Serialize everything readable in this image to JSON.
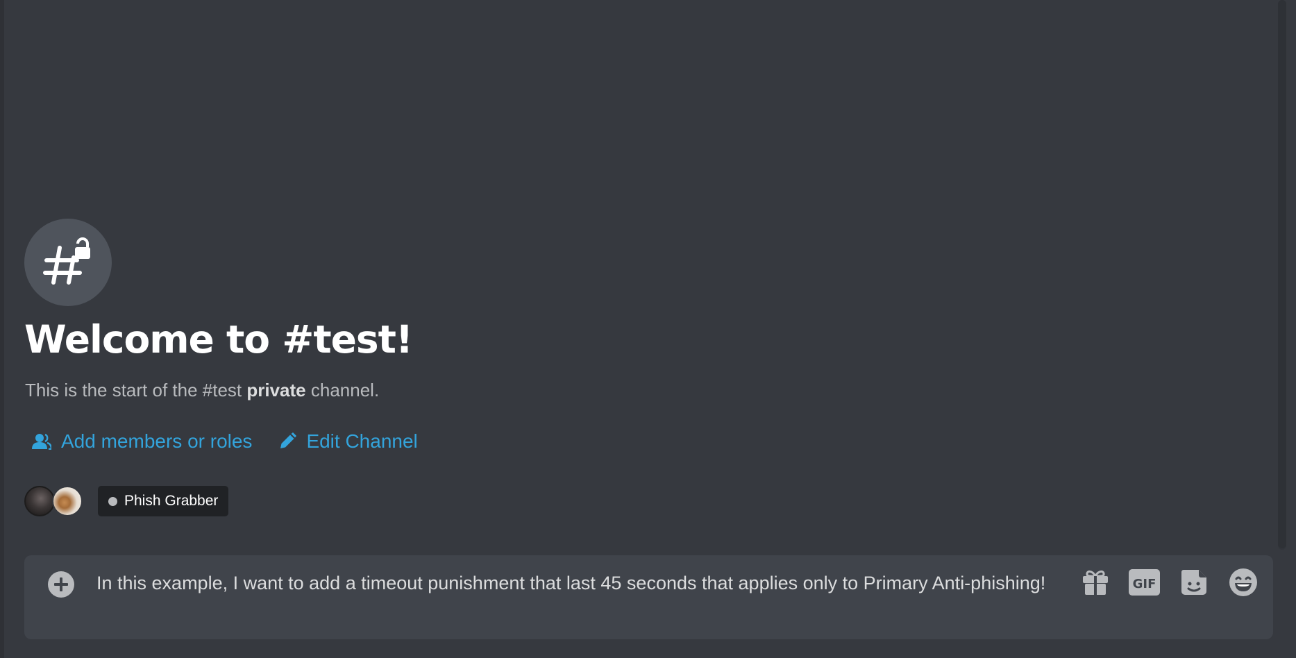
{
  "channel": {
    "welcome_title": "Welcome to #test!",
    "description_prefix": "This is the start of the #test ",
    "description_bold": "private",
    "description_suffix": " channel."
  },
  "actions": {
    "add_members_label": "Add members or roles",
    "edit_channel_label": "Edit Channel"
  },
  "members": {
    "tag_label": "Phish Grabber"
  },
  "composer": {
    "text": "In this example, I want to add a timeout punishment that last 45 seconds that applies only to Primary Anti-phishing!"
  },
  "icons": {
    "channel": "locked-hash-icon",
    "add_members": "person-icon",
    "edit": "pencil-icon",
    "upload": "plus-circle-icon",
    "gift": "gift-icon",
    "gif": "gif-icon",
    "sticker": "sticker-icon",
    "emoji": "emoji-icon"
  },
  "colors": {
    "background": "#36393f",
    "link": "#33a4dc",
    "composer": "#40444b",
    "tag_background": "#202225"
  }
}
